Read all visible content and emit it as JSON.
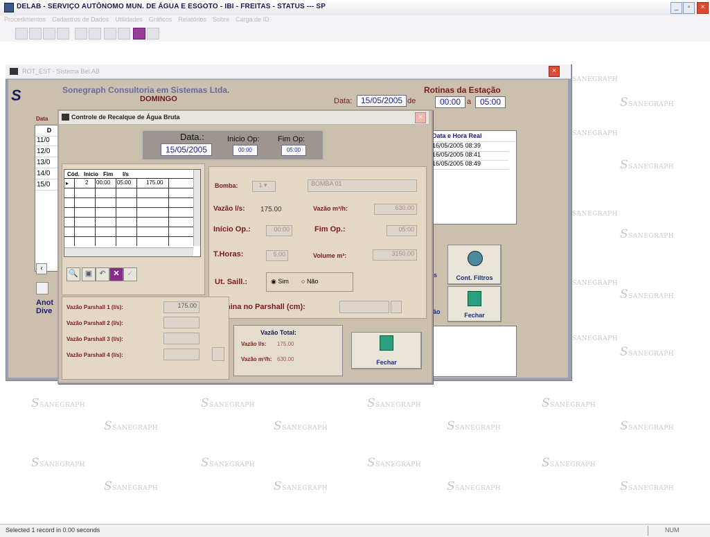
{
  "window": {
    "title": "DELAB - SERVIÇO AUTÔNOMO MUN. DE ÁGUA E ESGOTO - IBI - FREITAS - STATUS --- SP",
    "menu": [
      "Procedimentos",
      "Cadastros de Dados",
      "Utilidades",
      "Gráficos",
      "Relatórios",
      "Sobre",
      "Carga de ID"
    ]
  },
  "midwin": {
    "title": "ROT_EST - Sistema Bel.AB",
    "company": "Sonegraph Consultoria em Sistemas Ltda.",
    "day": "DOMINGO",
    "date_label": "Data:",
    "date_value": "15/05/2005",
    "de_label": "de",
    "a_label": "a",
    "routines_title": "Rotinas da Estação",
    "time_from": "00:00",
    "time_to": "05:00",
    "left_list": [
      "11/0",
      "12/0",
      "13/0",
      "14/0",
      "15/0"
    ],
    "data_header": "Data",
    "col_d": "D",
    "right_list_header": "Data e Hora Real",
    "right_list": [
      "16/05/2005 08:39",
      "16/05/2005 08:41",
      "16/05/2005 08:49"
    ],
    "anot_label": "Anot",
    "dive_label": "Dive",
    "cont_filtros": "Cont. Filtros",
    "fechar": "Fechar",
    "side_fragment_1": "s",
    "side_fragment_2": "ção"
  },
  "dialog": {
    "title": "Controle de Recalque de Água Bruta",
    "data_label": "Data.:",
    "data_value": "15/05/2005",
    "inicio_op_label": "Inicio Op:",
    "inicio_op_value": "00:00",
    "fim_op_label": "Fim Op:",
    "fim_op_value": "05:00",
    "grid": {
      "headers": [
        "Cód.",
        "Inicio",
        "Fim",
        "l/s"
      ],
      "row": [
        "2",
        "00:00",
        "05:00",
        "175.00"
      ]
    },
    "bomba_label": "Bomba:",
    "bomba_value": "1",
    "bomba_name": "BOMBA 01",
    "vazao_ls_label": "Vazão l/s:",
    "vazao_ls_value": "175.00",
    "vazao_m3h_label": "Vazão m³/h:",
    "vazao_m3h_value": "630.00",
    "inicio_op2_label": "Início Op.:",
    "inicio_op2_value": "00:00",
    "fim_op2_label": "Fim Op.:",
    "fim_op2_value": "05:00",
    "thoras_label": "T.Horas:",
    "thoras_value": "5.00",
    "volume_label": "Volume m³:",
    "volume_value": "3150.00",
    "ut_saill_label": "Ut. Saill.:",
    "sim_label": "Sim",
    "nao_label": "Não",
    "lamina_label": "Lâmina no Parshall (cm):",
    "parshall_labels": [
      "Vazão Parshall 1 (l/s):",
      "Vazão Parshall 2 (l/s):",
      "Vazão Parshall 3 (l/s):",
      "Vazão Parshall 4 (l/s):"
    ],
    "parshall_1_value": "175.00",
    "vazao_total_title": "Vazão Total:",
    "vazao_total_ls_label": "Vazão l/s:",
    "vazao_total_ls_value": "175.00",
    "vazao_total_m3h_label": "Vazão m³/h:",
    "vazao_total_m3h_value": "630.00",
    "fechar": "Fechar"
  },
  "watermark": "SANEGRAPH",
  "status": {
    "message": "Selected 1 record in 0.00 seconds",
    "num": "NUM"
  },
  "colors": {
    "dialog_bg": "#cbbfae",
    "panel_bg": "#e4d8c5",
    "navy_text": "#1a1a9a",
    "maroon_text": "#7a1a1a",
    "close_red": "#d94a30"
  }
}
